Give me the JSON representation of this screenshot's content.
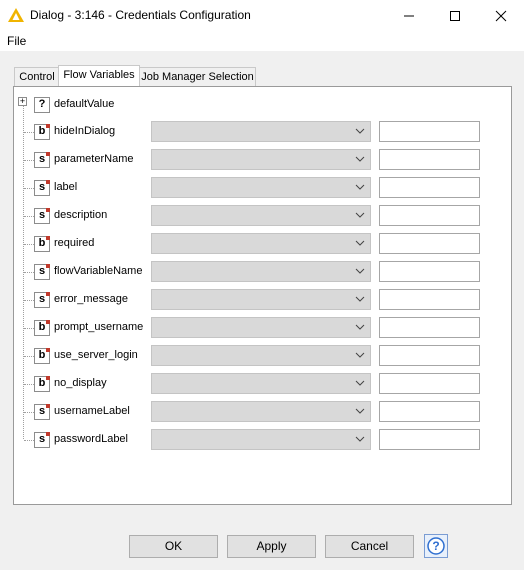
{
  "window": {
    "title": "Dialog - 3:146 - Credentials Configuration"
  },
  "menu": {
    "file": "File"
  },
  "tabs": [
    {
      "label": "Control"
    },
    {
      "label": "Flow Variables"
    },
    {
      "label": "Job Manager Selection"
    }
  ],
  "tree": {
    "root": {
      "label": "defaultValue",
      "type_icon": "?"
    },
    "rows": [
      {
        "label": "hideInDialog",
        "type_icon": "b"
      },
      {
        "label": "parameterName",
        "type_icon": "s"
      },
      {
        "label": "label",
        "type_icon": "s"
      },
      {
        "label": "description",
        "type_icon": "s"
      },
      {
        "label": "required",
        "type_icon": "b"
      },
      {
        "label": "flowVariableName",
        "type_icon": "s"
      },
      {
        "label": "error_message",
        "type_icon": "s"
      },
      {
        "label": "prompt_username",
        "type_icon": "b"
      },
      {
        "label": "use_server_login",
        "type_icon": "b"
      },
      {
        "label": "no_display",
        "type_icon": "b"
      },
      {
        "label": "usernameLabel",
        "type_icon": "s"
      },
      {
        "label": "passwordLabel",
        "type_icon": "s"
      }
    ]
  },
  "buttons": {
    "ok": "OK",
    "apply": "Apply",
    "cancel": "Cancel",
    "help": "?"
  },
  "colors": {
    "icon_accent": "#c0392b",
    "title_icon": "#f0b400"
  }
}
